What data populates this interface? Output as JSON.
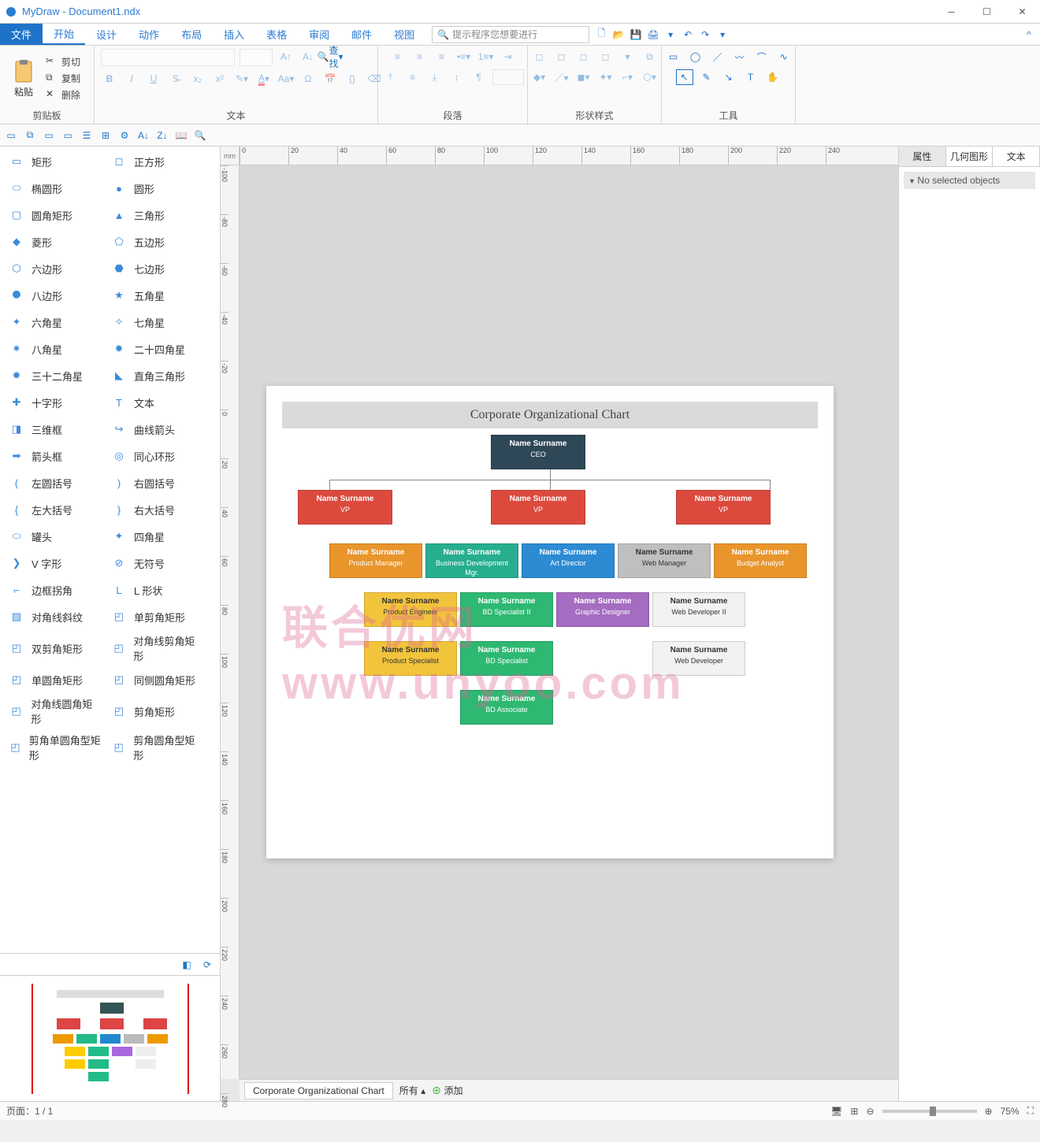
{
  "app": {
    "title": "MyDraw - Document1.ndx"
  },
  "menu": {
    "file": "文件",
    "items": [
      "开始",
      "设计",
      "动作",
      "布局",
      "插入",
      "表格",
      "审阅",
      "邮件",
      "视图"
    ],
    "search_placeholder": "提示程序您想要进行",
    "help": "^"
  },
  "ribbon": {
    "clipboard": {
      "label": "剪贴板",
      "paste": "粘贴",
      "cut": "剪切",
      "copy": "复制",
      "delete": "删除"
    },
    "text": {
      "label": "文本",
      "find": "查找"
    },
    "paragraph": {
      "label": "段落"
    },
    "shape_style": {
      "label": "形状样式"
    },
    "tools": {
      "label": "工具"
    }
  },
  "shapes": {
    "rows": [
      [
        "矩形",
        "正方形"
      ],
      [
        "椭圆形",
        "圆形"
      ],
      [
        "圆角矩形",
        "三角形"
      ],
      [
        "菱形",
        "五边形"
      ],
      [
        "六边形",
        "七边形"
      ],
      [
        "八边形",
        "五角星"
      ],
      [
        "六角星",
        "七角星"
      ],
      [
        "八角星",
        "二十四角星"
      ],
      [
        "三十二角星",
        "直角三角形"
      ],
      [
        "十字形",
        "文本"
      ],
      [
        "三维框",
        "曲线箭头"
      ],
      [
        "箭头框",
        "同心环形"
      ],
      [
        "左圆括号",
        "右圆括号"
      ],
      [
        "左大括号",
        "右大括号"
      ],
      [
        "罐头",
        "四角星"
      ],
      [
        "V 字形",
        "无符号"
      ],
      [
        "边框拐角",
        "L 形状"
      ],
      [
        "对角线斜纹",
        "单剪角矩形"
      ],
      [
        "双剪角矩形",
        "对角线剪角矩形"
      ],
      [
        "单圆角矩形",
        "同侧圆角矩形"
      ],
      [
        "对角线圆角矩形",
        "剪角矩形"
      ],
      [
        "剪角单圆角型矩形",
        "剪角圆角型矩形"
      ]
    ]
  },
  "ruler": {
    "unit": "mm",
    "h": [
      "0",
      "20",
      "40",
      "60",
      "80",
      "100",
      "120",
      "140",
      "160",
      "180",
      "200",
      "220",
      "240"
    ],
    "v": [
      "-100",
      "-80",
      "-60",
      "-40",
      "-20",
      "0",
      "20",
      "40",
      "60",
      "80",
      "100",
      "120",
      "140",
      "160",
      "180",
      "200",
      "220",
      "240",
      "260",
      "280"
    ]
  },
  "page_tabs": {
    "tab1": "Corporate Organizational Chart",
    "all": "所有",
    "add": "添加"
  },
  "org_chart": {
    "title": "Corporate Organizational Chart",
    "name": "Name Surname",
    "roles": {
      "ceo": "CEO",
      "vp": "VP",
      "pm": "Product Manager",
      "bdm": "Business Development Mgr.",
      "ad": "Art Director",
      "wm": "Web Manager",
      "ba": "Budget Analyst",
      "pe": "Product Engineer",
      "bds2": "BD Specialist II",
      "gd": "Graphic Designer",
      "wd2": "Web Developer II",
      "ps": "Product Specialist",
      "bds": "BD Specialist",
      "wd": "Web Developer",
      "bda": "BD Associate"
    }
  },
  "right_panel": {
    "tabs": [
      "属性",
      "几何图形",
      "文本"
    ],
    "empty": "No selected objects"
  },
  "status": {
    "page": "页面：1 / 1",
    "zoom": "75%"
  },
  "watermark": "联合优网 www.unyoo.com"
}
